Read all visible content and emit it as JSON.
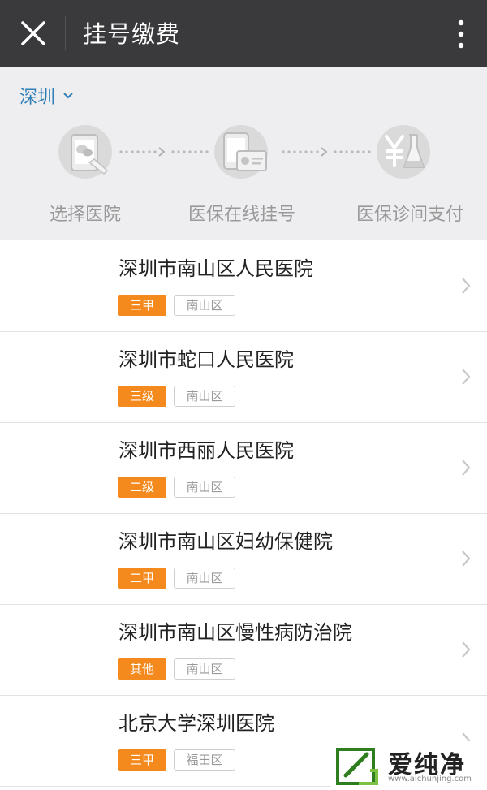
{
  "titlebar": {
    "title": "挂号缴费"
  },
  "city": {
    "label": "深圳"
  },
  "steps": [
    {
      "label": "选择医院",
      "icon": "phone-chat-icon"
    },
    {
      "label": "医保在线挂号",
      "icon": "phone-card-icon"
    },
    {
      "label": "医保诊间支付",
      "icon": "yuan-flask-icon"
    }
  ],
  "hospitals": [
    {
      "name": "深圳市南山区人民医院",
      "level": "三甲",
      "district": "南山区"
    },
    {
      "name": "深圳市蛇口人民医院",
      "level": "三级",
      "district": "南山区"
    },
    {
      "name": "深圳市西丽人民医院",
      "level": "二级",
      "district": "南山区"
    },
    {
      "name": "深圳市南山区妇幼保健院",
      "level": "二甲",
      "district": "南山区"
    },
    {
      "name": "深圳市南山区慢性病防治院",
      "level": "其他",
      "district": "南山区"
    },
    {
      "name": "北京大学深圳医院",
      "level": "三甲",
      "district": "福田区"
    }
  ],
  "watermark": {
    "text": "爱纯净",
    "url": "www.aichunjing.com"
  },
  "colors": {
    "titlebar": "#3a3a3c",
    "accent_blue": "#2f7fb7",
    "tag_orange": "#f48a1e",
    "panel_bg": "#eeeef0"
  }
}
